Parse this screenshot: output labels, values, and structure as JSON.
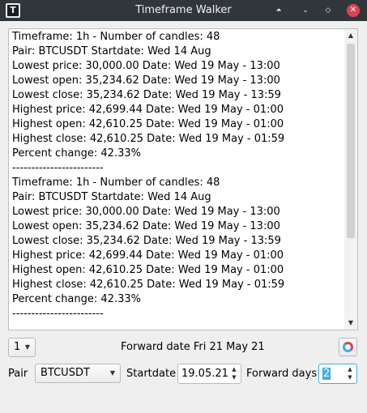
{
  "window": {
    "title": "Timeframe Walker",
    "app_icon_glyph": "T",
    "buttons": {
      "shade_glyph": "⏶",
      "minimize_glyph": "⌄",
      "maximize_glyph": "◇",
      "close_glyph": "✕"
    }
  },
  "output": {
    "lines": [
      "Timeframe: 1h - Number of candles: 48",
      "Pair: BTCUSDT Startdate: Wed 14 Aug",
      "Lowest price: 30,000.00 Date: Wed 19 May - 13:00",
      "Lowest open: 35,234.62 Date: Wed 19 May - 13:00",
      "Lowest close: 35,234.62 Date: Wed 19 May - 13:59",
      "Highest price: 42,699.44 Date: Wed 19 May - 01:00",
      "Highest open: 42,610.25 Date: Wed 19 May - 01:00",
      "Highest close: 42,610.25 Date: Wed 19 May - 01:59",
      "Percent change: 42.33%",
      "------------------------",
      "Timeframe: 1h - Number of candles: 48",
      "Pair: BTCUSDT Startdate: Wed 14 Aug",
      "Lowest price: 30,000.00 Date: Wed 19 May - 13:00",
      "Lowest open: 35,234.62 Date: Wed 19 May - 13:00",
      "Lowest close: 35,234.62 Date: Wed 19 May - 13:59",
      "Highest price: 42,699.44 Date: Wed 19 May - 01:00",
      "Highest open: 42,610.25 Date: Wed 19 May - 01:00",
      "Highest close: 42,610.25 Date: Wed 19 May - 01:59",
      "Percent change: 42.33%",
      "------------------------"
    ]
  },
  "controls": {
    "count_select_value": "1",
    "forward_date_label": "Forward date Fri 21 May 21",
    "refresh_icon": "refresh-icon",
    "pair_label": "Pair",
    "pair_value": "BTCUSDT",
    "startdate_label": "Startdate",
    "startdate_value": "19.05.21",
    "forward_days_label": "Forward days",
    "forward_days_value": "2"
  },
  "colors": {
    "titlebar": "#31363b",
    "accent": "#3daee9",
    "close": "#da4453"
  }
}
